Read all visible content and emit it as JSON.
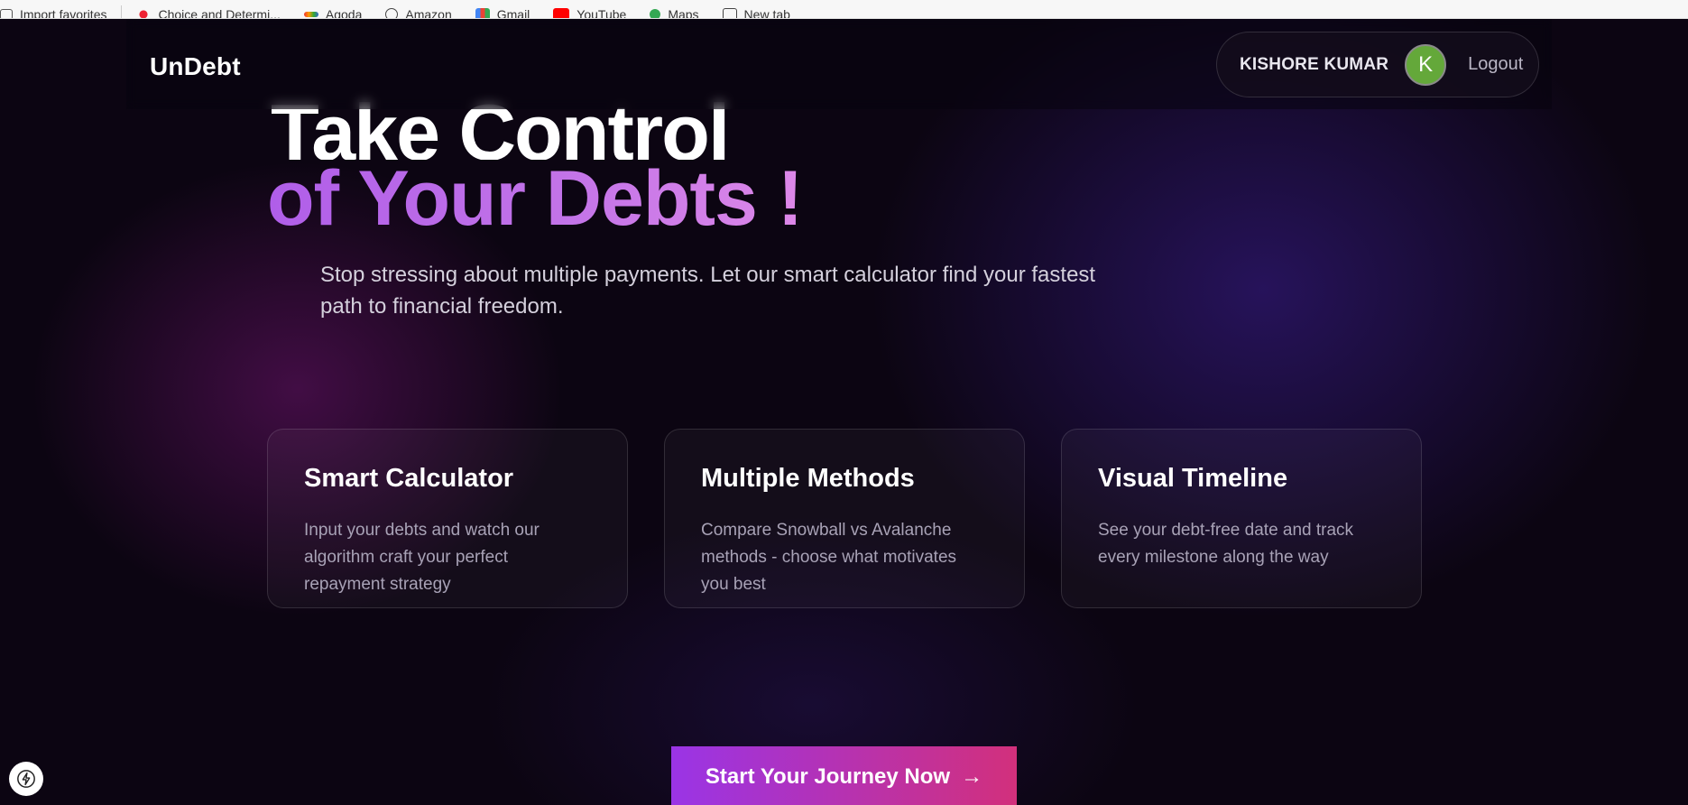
{
  "bookmarks": {
    "items": [
      {
        "label": "Import favorites",
        "icon": "import-icon"
      },
      {
        "label": "Choice and Determi...",
        "icon": "bookmark-icon"
      },
      {
        "label": "Agoda",
        "icon": "agoda-icon"
      },
      {
        "label": "Amazon",
        "icon": "globe-icon"
      },
      {
        "label": "Gmail",
        "icon": "gmail-icon"
      },
      {
        "label": "YouTube",
        "icon": "youtube-icon"
      },
      {
        "label": "Maps",
        "icon": "maps-icon"
      },
      {
        "label": "New tab",
        "icon": "new-tab-icon"
      }
    ]
  },
  "navbar": {
    "logo": "UnDebt",
    "user_name": "KISHORE KUMAR",
    "avatar_letter": "K",
    "logout_label": "Logout"
  },
  "hero": {
    "line1": "Take Control",
    "line2": "of Your Debts !",
    "subtitle": "Stop stressing about multiple payments. Let our smart calculator find your fastest path to financial freedom."
  },
  "features": [
    {
      "title": "Smart Calculator",
      "description": "Input your debts and watch our algorithm craft your perfect repayment strategy"
    },
    {
      "title": "Multiple Methods",
      "description": "Compare Snowball vs Avalanche methods - choose what motivates you best"
    },
    {
      "title": "Visual Timeline",
      "description": "See your debt-free date and track every milestone along the way"
    }
  ],
  "cta": {
    "label": "Start Your Journey Now",
    "arrow": "→"
  },
  "colors": {
    "accent_purple": "#b05ee9",
    "cta_start": "#9a34e6",
    "cta_end": "#d2307c",
    "avatar": "#64a83a"
  }
}
